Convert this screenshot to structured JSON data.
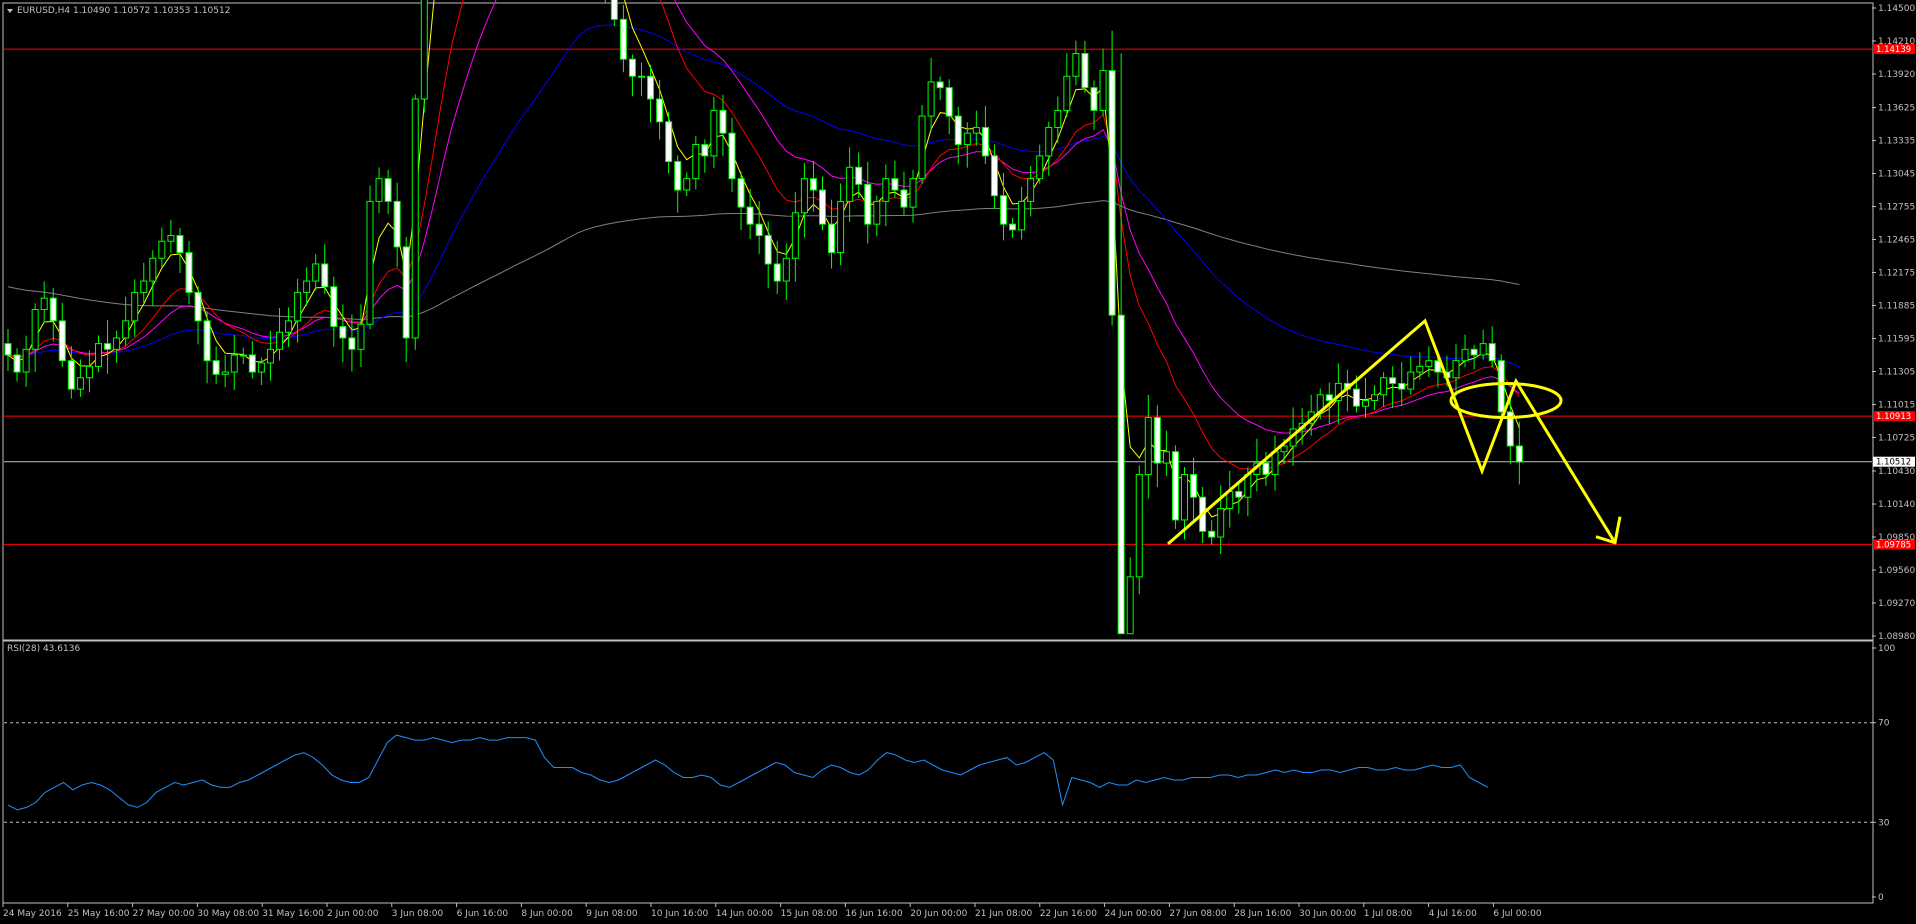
{
  "header": {
    "symbol_line": "EURUSD,H4  1.10490 1.10572 1.10353 1.10512"
  },
  "rsi_label": "RSI(28) 43.6136",
  "colors": {
    "background": "#000000",
    "candle": "#00ff00",
    "level_line": "#ff0000",
    "current_line": "#c0c0c0",
    "ma_fast": "#ffff00",
    "ma_red": "#ff0000",
    "ma_magenta": "#ff00ff",
    "ma_blue": "#0000ff",
    "ma_gray": "#808080",
    "rsi_line": "#1e90ff",
    "annotation": "#ffff00",
    "price_tag_red": "#ff0000",
    "price_tag_white": "#ffffff"
  },
  "chart_data": [
    {
      "type": "candlestick",
      "symbol": "EURUSD",
      "timeframe": "H4",
      "ohlc_last": {
        "open": 1.1049,
        "high": 1.10572,
        "low": 1.10353,
        "close": 1.10512
      },
      "ylim": [
        1.0898,
        1.145
      ],
      "y_ticks": [
        "1.14500",
        "1.14210",
        "1.13920",
        "1.13625",
        "1.13335",
        "1.13045",
        "1.12755",
        "1.12465",
        "1.12175",
        "1.11885",
        "1.11595",
        "1.11305",
        "1.11015",
        "1.10725",
        "1.10430",
        "1.10140",
        "1.09850",
        "1.09560",
        "1.09270",
        "1.08980"
      ],
      "x_ticks": [
        "24 May 2016",
        "25 May 16:00",
        "27 May 00:00",
        "30 May 08:00",
        "31 May 16:00",
        "2 Jun 00:00",
        "3 Jun 08:00",
        "6 Jun 16:00",
        "8 Jun 00:00",
        "9 Jun 08:00",
        "10 Jun 16:00",
        "14 Jun 00:00",
        "15 Jun 08:00",
        "16 Jun 16:00",
        "20 Jun 00:00",
        "21 Jun 08:00",
        "22 Jun 16:00",
        "24 Jun 00:00",
        "27 Jun 08:00",
        "28 Jun 16:00",
        "30 Jun 00:00",
        "1 Jul 08:00",
        "4 Jul 16:00",
        "6 Jul 00:00"
      ],
      "horizontal_levels": [
        {
          "price": 1.14139,
          "label": "1.14139",
          "style": "red"
        },
        {
          "price": 1.10913,
          "label": "1.10913",
          "style": "red"
        },
        {
          "price": 1.09785,
          "label": "1.09785",
          "style": "red"
        },
        {
          "price": 1.10512,
          "label": "1.10512",
          "style": "current"
        }
      ],
      "close_path": [
        1.1145,
        1.113,
        1.115,
        1.1185,
        1.1195,
        1.1175,
        1.114,
        1.1115,
        1.1125,
        1.1135,
        1.1155,
        1.115,
        1.116,
        1.1175,
        1.12,
        1.121,
        1.123,
        1.1245,
        1.125,
        1.1235,
        1.12,
        1.1175,
        1.114,
        1.1128,
        1.113,
        1.1145,
        1.1145,
        1.113,
        1.1138,
        1.115,
        1.1165,
        1.1175,
        1.12,
        1.121,
        1.1225,
        1.1205,
        1.117,
        1.116,
        1.115,
        1.1172,
        1.128,
        1.13,
        1.128,
        1.124,
        1.116,
        1.137,
        1.15,
        1.158,
        1.164,
        1.166,
        1.1625,
        1.164,
        1.164,
        1.1635,
        1.163,
        1.165,
        1.1655,
        1.1635,
        1.164,
        1.165,
        1.1675,
        1.17,
        1.1705,
        1.1695,
        1.158,
        1.15,
        1.146,
        1.144,
        1.1405,
        1.139,
        1.139,
        1.137,
        1.135,
        1.1315,
        1.129,
        1.13,
        1.133,
        1.132,
        1.136,
        1.134,
        1.13,
        1.1275,
        1.126,
        1.125,
        1.1225,
        1.121,
        1.123,
        1.127,
        1.13,
        1.129,
        1.126,
        1.1235,
        1.128,
        1.131,
        1.1295,
        1.126,
        1.128,
        1.13,
        1.129,
        1.1275,
        1.13,
        1.1355,
        1.1385,
        1.138,
        1.1355,
        1.133,
        1.134,
        1.1345,
        1.132,
        1.1285,
        1.126,
        1.1255,
        1.128,
        1.13,
        1.132,
        1.1345,
        1.136,
        1.139,
        1.141,
        1.138,
        1.136,
        1.1395,
        1.118,
        1.09,
        1.095,
        1.104,
        1.109,
        1.105,
        1.106,
        1.1,
        1.104,
        1.102,
        1.099,
        1.0985,
        1.101,
        1.1025,
        1.102,
        1.104,
        1.105,
        1.104,
        1.106,
        1.1065,
        1.108,
        1.1085,
        1.1095,
        1.111,
        1.1105,
        1.112,
        1.1115,
        1.11,
        1.1105,
        1.111,
        1.1125,
        1.112,
        1.1115,
        1.113,
        1.1135,
        1.114,
        1.113,
        1.1125,
        1.114,
        1.115,
        1.1145,
        1.1155,
        1.114,
        1.1095,
        1.1065,
        1.1051
      ],
      "annotations": [
        {
          "type": "line",
          "from": {
            "x": "27 Jun 08:00",
            "y": 1.0979
          },
          "to": {
            "x": "4 Jul 16:00",
            "y": 1.1175
          }
        },
        {
          "type": "line",
          "from": {
            "x": "4 Jul 16:00",
            "y": 1.1175
          },
          "to": {
            "x": "6 Jul 00:00",
            "y": 1.1043
          }
        },
        {
          "type": "line",
          "from": {
            "x": "6 Jul 00:00",
            "y": 1.1043
          },
          "to": {
            "x": "after 6 Jul",
            "y": 1.1122
          }
        },
        {
          "type": "arrow",
          "from": {
            "x": "after 6 Jul",
            "y": 1.1122
          },
          "to": {
            "x": "after 6 Jul",
            "y": 1.098
          }
        },
        {
          "type": "ellipse",
          "center_price": 1.1105
        }
      ]
    },
    {
      "type": "line",
      "indicator": "RSI(28)",
      "value": 43.6136,
      "ylim": [
        0,
        100
      ],
      "y_ticks": [
        "100",
        "70",
        "30",
        "0"
      ],
      "levels": [
        70,
        30
      ],
      "values": [
        37,
        35,
        36,
        38,
        42,
        44,
        46,
        43,
        45,
        46,
        45,
        43,
        40,
        37,
        36,
        38,
        42,
        44,
        46,
        45,
        46,
        47,
        45,
        44,
        44,
        46,
        47,
        49,
        51,
        53,
        55,
        57,
        58,
        56,
        53,
        49,
        47,
        46,
        46,
        48,
        55,
        62,
        65,
        64,
        63,
        63,
        64,
        63,
        62,
        63,
        63,
        64,
        63,
        63,
        64,
        64,
        64,
        63,
        56,
        52,
        52,
        52,
        50,
        49,
        47,
        46,
        47,
        49,
        51,
        53,
        55,
        53,
        50,
        48,
        48,
        49,
        48,
        45,
        44,
        46,
        48,
        50,
        52,
        54,
        53,
        50,
        49,
        48,
        51,
        53,
        52,
        50,
        49,
        51,
        55,
        58,
        57,
        55,
        54,
        55,
        53,
        51,
        50,
        49,
        51,
        53,
        54,
        55,
        56,
        53,
        54,
        56,
        58,
        55,
        37,
        48,
        47,
        46,
        44,
        46,
        45,
        45,
        47,
        46,
        47,
        48,
        47,
        47,
        48,
        48,
        48,
        49,
        49,
        48,
        49,
        49,
        50,
        51,
        50,
        51,
        50,
        50,
        51,
        51,
        50,
        51,
        52,
        52,
        51,
        51,
        52,
        51,
        51,
        52,
        53,
        52,
        52,
        53,
        48,
        46,
        44
      ]
    }
  ]
}
